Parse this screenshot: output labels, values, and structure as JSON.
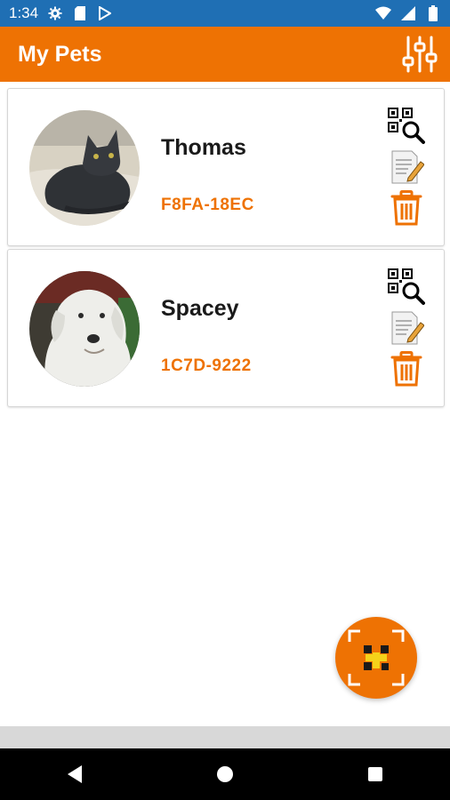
{
  "status_bar": {
    "time": "1:34",
    "left_icons": [
      "settings-icon",
      "sd-card-icon",
      "play-store-icon"
    ],
    "right_icons": [
      "wifi-icon",
      "signal-icon",
      "battery-icon"
    ]
  },
  "app_bar": {
    "title": "My Pets",
    "action_icon": "filter-sliders-icon"
  },
  "pets": [
    {
      "name": "Thomas",
      "code": "F8FA-18EC",
      "photo": "black cat lying on blanket"
    },
    {
      "name": "Spacey",
      "code": "1C7D-9222",
      "photo": "white labrador dog"
    }
  ],
  "card_actions": [
    "qr-search-icon",
    "edit-note-icon",
    "trash-icon"
  ],
  "fab": {
    "icon": "qr-add-icon"
  },
  "nav_bar": {
    "buttons": [
      "back-icon",
      "home-icon",
      "recents-icon"
    ]
  },
  "colors": {
    "status_bar": "#1f6fb4",
    "accent": "#ee7203",
    "nav_bar": "#000000"
  }
}
